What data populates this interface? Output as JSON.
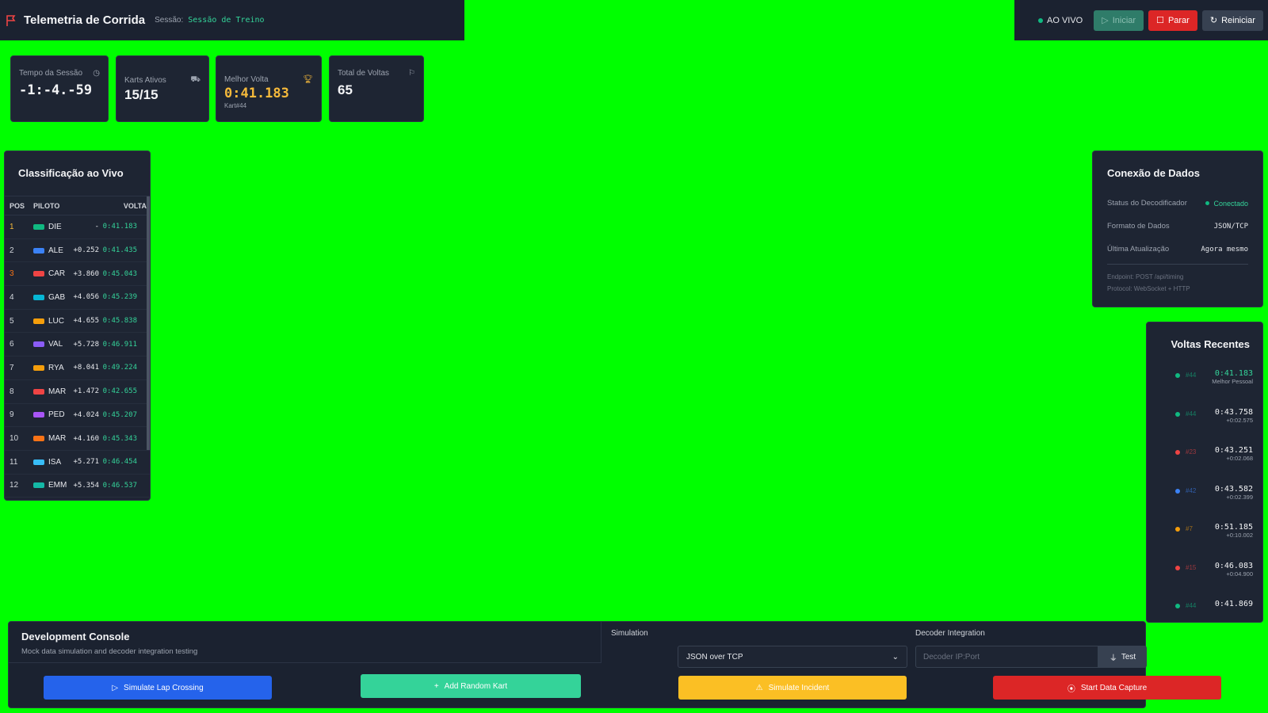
{
  "header": {
    "title": "Telemetria de Corrida",
    "session_label": "Sessão:",
    "session_value": "Sessão de Treino",
    "live_label": "AO VIVO",
    "start_label": "Iniciar",
    "stop_label": "Parar",
    "reset_label": "Reiniciar"
  },
  "stats": {
    "session_time": {
      "label": "Tempo da Sessão",
      "value": "-1:-4.-59"
    },
    "active_karts": {
      "label": "Karts Ativos",
      "value": "15/15"
    },
    "best_lap": {
      "label": "Melhor Volta",
      "value": "0:41.183",
      "sub": "Kart#44"
    },
    "total_laps": {
      "label": "Total de Voltas",
      "value": "65"
    }
  },
  "leaderboard": {
    "title": "Classificação ao Vivo",
    "headers": {
      "pos": "POS",
      "pilot": "PILOTO",
      "lap": "VOLTA"
    },
    "rows": [
      {
        "pos": "1",
        "name": "DIE",
        "gap": "-",
        "lap": "0:41.183",
        "color": "#10b981"
      },
      {
        "pos": "2",
        "name": "ALE",
        "gap": "+0.252",
        "lap": "0:41.435",
        "color": "#3b82f6"
      },
      {
        "pos": "3",
        "name": "CAR",
        "gap": "+3.860",
        "lap": "0:45.043",
        "color": "#ef4444"
      },
      {
        "pos": "4",
        "name": "GAB",
        "gap": "+4.056",
        "lap": "0:45.239",
        "color": "#06b6d4"
      },
      {
        "pos": "5",
        "name": "LUC",
        "gap": "+4.655",
        "lap": "0:45.838",
        "color": "#f59e0b"
      },
      {
        "pos": "6",
        "name": "VAL",
        "gap": "+5.728",
        "lap": "0:46.911",
        "color": "#8b5cf6"
      },
      {
        "pos": "7",
        "name": "RYA",
        "gap": "+8.041",
        "lap": "0:49.224",
        "color": "#f59e0b"
      },
      {
        "pos": "8",
        "name": "MAR",
        "gap": "+1.472",
        "lap": "0:42.655",
        "color": "#ef4444"
      },
      {
        "pos": "9",
        "name": "PED",
        "gap": "+4.024",
        "lap": "0:45.207",
        "color": "#a855f7"
      },
      {
        "pos": "10",
        "name": "MAR",
        "gap": "+4.160",
        "lap": "0:45.343",
        "color": "#f97316"
      },
      {
        "pos": "11",
        "name": "ISA",
        "gap": "+5.271",
        "lap": "0:46.454",
        "color": "#38bdf8"
      },
      {
        "pos": "12",
        "name": "EMM",
        "gap": "+5.354",
        "lap": "0:46.537",
        "color": "#14b8a6"
      }
    ]
  },
  "connection": {
    "title": "Conexão de Dados",
    "decoder_label": "Status do Decodificador",
    "decoder_value": "Conectado",
    "format_label": "Formato de Dados",
    "format_value": "JSON/TCP",
    "update_label": "Última Atualização",
    "update_value": "Agora mesmo",
    "endpoint": "Endpoint: POST /api/timing",
    "protocol": "Protocol: WebSocket + HTTP"
  },
  "recent": {
    "title": "Voltas Recentes",
    "laps": [
      {
        "kart": "#44",
        "time": "0:41.183",
        "delta": "Melhor Pessoal",
        "color": "#10b981",
        "best": true
      },
      {
        "kart": "#44",
        "time": "0:43.758",
        "delta": "+0:02.575",
        "color": "#10b981",
        "best": false
      },
      {
        "kart": "#23",
        "time": "0:43.251",
        "delta": "+0:02.068",
        "color": "#ef4444",
        "best": false
      },
      {
        "kart": "#42",
        "time": "0:43.582",
        "delta": "+0:02.399",
        "color": "#3b82f6",
        "best": false
      },
      {
        "kart": "#7",
        "time": "0:51.185",
        "delta": "+0:10.002",
        "color": "#f59e0b",
        "best": false
      },
      {
        "kart": "#15",
        "time": "0:46.083",
        "delta": "+0:04.900",
        "color": "#ef4444",
        "best": false
      },
      {
        "kart": "#44",
        "time": "0:41.869",
        "delta": "",
        "color": "#10b981",
        "best": false
      }
    ]
  },
  "dev": {
    "title": "Development Console",
    "subtitle": "Mock data simulation and decoder integration testing",
    "simulation_label": "Simulation",
    "decoder_label": "Decoder Integration",
    "format_select": "JSON over TCP",
    "decoder_placeholder": "Decoder IP:Port",
    "test_label": "Test",
    "lap_crossing": "Simulate Lap Crossing",
    "random_kart": "Add Random Kart",
    "incident": "Simulate Incident",
    "capture": "Start Data Capture"
  }
}
